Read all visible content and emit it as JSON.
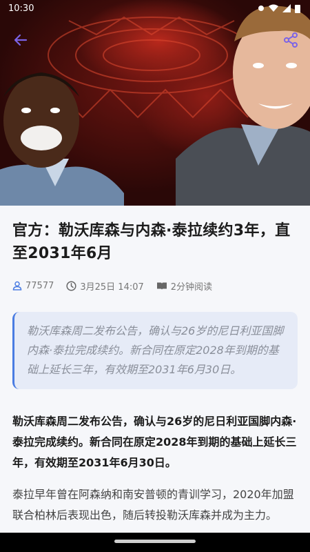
{
  "status_bar": {
    "time": "10:30"
  },
  "hero": {
    "image": "players-photo"
  },
  "article": {
    "title": "官方：勒沃库森与内森·泰拉续约3年，直至2031年6月",
    "meta": {
      "views": "77577",
      "date": "3月25日 14:07",
      "read_time": "2分钟阅读"
    },
    "summary": "勒沃库森周二发布公告，确认与26岁的尼日利亚国脚内森·泰拉完成续约。新合同在原定2028年到期的基础上延长三年，有效期至2031年6月30日。",
    "paragraphs": [
      "勒沃库森周二发布公告，确认与26岁的尼日利亚国脚内森·泰拉完成续约。新合同在原定2028年到期的基础上延长三年，有效期至2031年6月30日。",
      "泰拉早年曾在阿森纳和南安普顿的青训学习，2020年加盟联合柏林后表现出色，随后转投勒沃库森并成为主力。"
    ]
  },
  "icons": {
    "back": "back-arrow-icon",
    "share": "share-icon",
    "views": "person-icon",
    "date": "clock-icon",
    "read": "book-icon"
  },
  "colors": {
    "accent": "#7b63e6",
    "summary_bg": "#e6ebf7",
    "summary_border": "#4a7ce2",
    "meta_icon": "#4a7ce2"
  }
}
